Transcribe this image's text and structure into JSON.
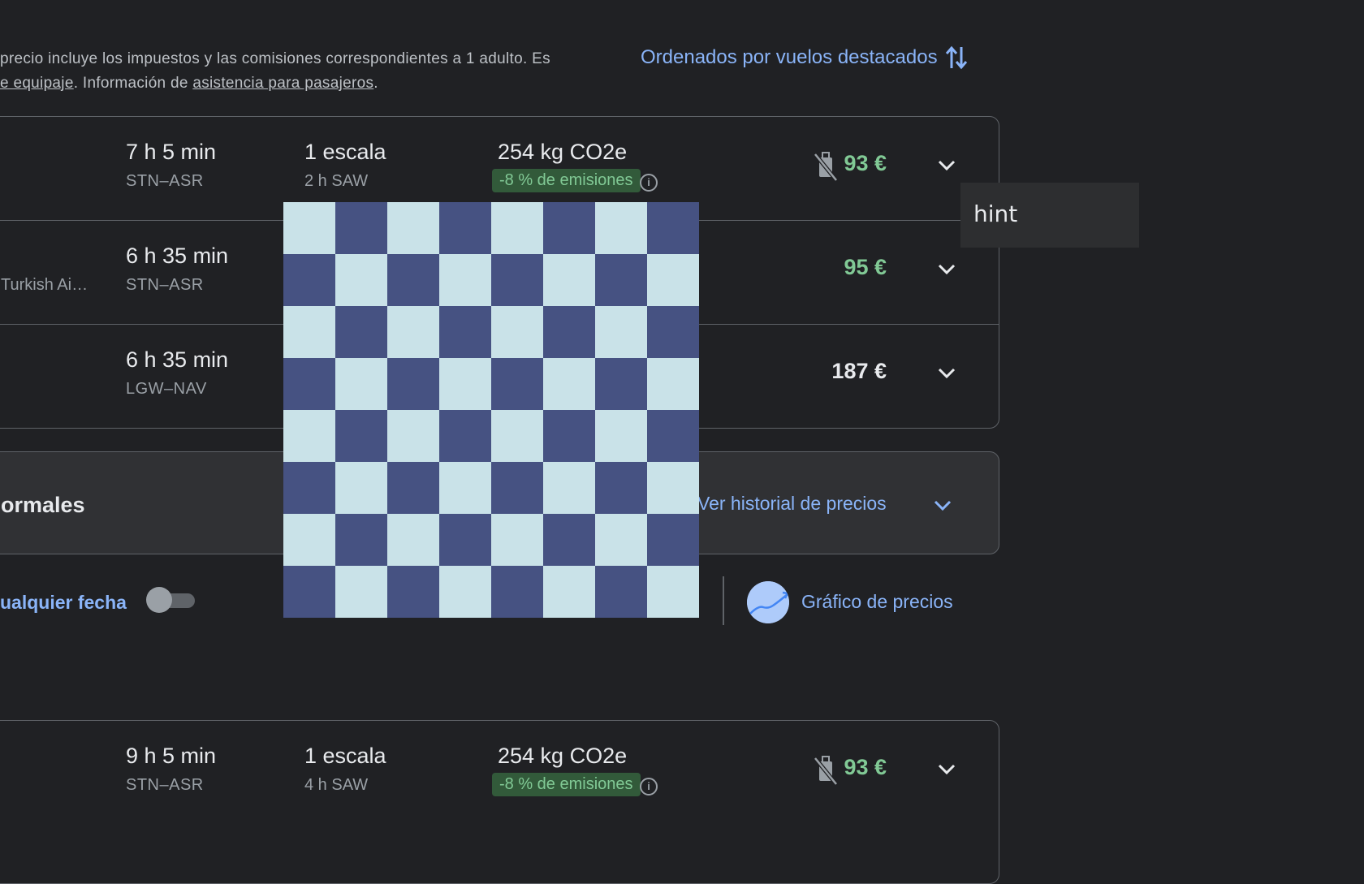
{
  "notice": {
    "line1": "precio incluye los impuestos y las comisiones correspondientes a 1 adulto. Es",
    "line2_link1": "e equipaje",
    "line2_mid": ". Información de ",
    "line2_link2": "asistencia para pasajeros",
    "line2_end": "."
  },
  "sort": {
    "label": "Ordenados por vuelos destacados",
    "icon": "swap-vert-icon"
  },
  "flights_top": [
    {
      "airline": "",
      "duration": "7 h 5 min",
      "route": "STN–ASR",
      "stops": "1 escala",
      "stop_detail": "2 h SAW",
      "co2": "254 kg CO2e",
      "emissions": "-8 % de emisiones",
      "price": "93 €",
      "no_bag": true,
      "price_color": "#81c995"
    },
    {
      "airline": "Turkish Airlines",
      "duration": "6 h 35 min",
      "route": "STN–ASR",
      "stops": "",
      "stop_detail": "",
      "co2": "",
      "emissions": "",
      "price": "95 €",
      "no_bag": false,
      "price_color": "#81c995"
    },
    {
      "airline": "",
      "duration": "6 h 35 min",
      "route": "LGW–NAV",
      "stops": "",
      "stop_detail": "",
      "co2": "",
      "emissions": "",
      "price": "187 €",
      "no_bag": false,
      "price_color": "#e8eaed"
    }
  ],
  "history": {
    "title": "ormales",
    "link": "Ver historial de precios"
  },
  "options": {
    "any_date": "ualquier fecha",
    "any_date_enabled": false,
    "price_graph": "Gráfico de precios"
  },
  "flights_bottom": [
    {
      "duration": "9 h 5 min",
      "route": "STN–ASR",
      "stops": "1 escala",
      "stop_detail": "4 h SAW",
      "co2": "254 kg CO2e",
      "emissions": "-8 % de emisiones",
      "price": "93 €"
    }
  ],
  "tooltip": {
    "text": "hint"
  },
  "colors": {
    "background": "#202124",
    "accent": "#8ab4f8",
    "price_green": "#81c995",
    "badge_bg": "#325a3a",
    "check_light": "#c9e2e8",
    "check_dark": "#465282"
  }
}
